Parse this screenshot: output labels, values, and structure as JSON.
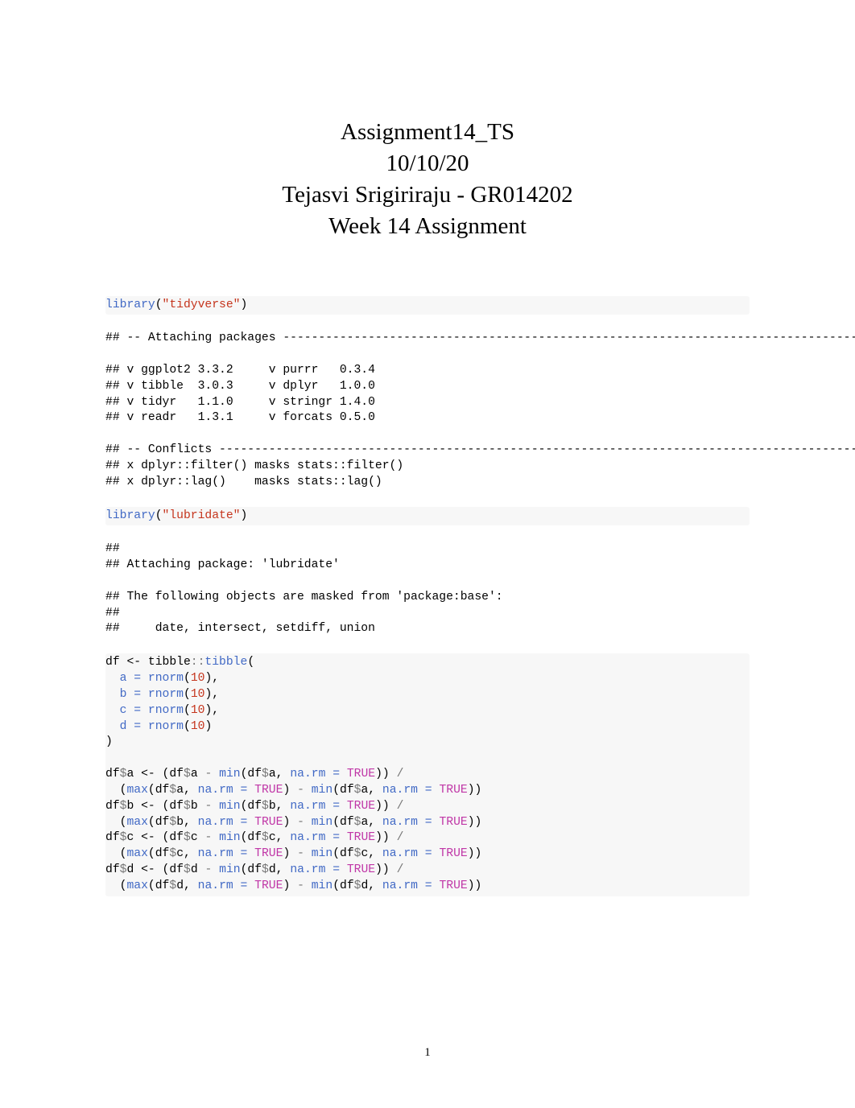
{
  "title": {
    "line1": "Assignment14_TS",
    "line2": "10/10/20",
    "line3": "Tejasvi Srigiriraju - GR014202",
    "line4": "Week 14 Assignment"
  },
  "code1_a": "library",
  "code1_b": "(",
  "code1_c": "\"tidyverse\"",
  "code1_d": ")",
  "output1": "## -- Attaching packages ---------------------------------------------------------------------------------",
  "packages": {
    "l1": "## v ggplot2 3.3.2     v purrr   0.3.4",
    "l2": "## v tibble  3.0.3     v dplyr   1.0.0",
    "l3": "## v tidyr   1.1.0     v stringr 1.4.0",
    "l4": "## v readr   1.3.1     v forcats 0.5.0"
  },
  "conflicts": {
    "l1": "## -- Conflicts ------------------------------------------------------------------------------------------",
    "l2": "## x dplyr::filter() masks stats::filter()",
    "l3": "## x dplyr::lag()    masks stats::lag()"
  },
  "code2_a": "library",
  "code2_b": "(",
  "code2_c": "\"lubridate\"",
  "code2_d": ")",
  "lubridate": {
    "l1": "##",
    "l2": "## Attaching package: 'lubridate'",
    "l3": "## The following objects are masked from 'package:base':",
    "l4": "##",
    "l5": "##     date, intersect, setdiff, union"
  },
  "df": {
    "l1a": "df <-",
    "l1b": " tibble",
    "l1c": "::",
    "l1d": "tibble",
    "l1e": "(",
    "l2a": "  ",
    "l2b": "a =",
    "l2c": " ",
    "l2d": "rnorm",
    "l2e": "(",
    "l2f": "10",
    "l2g": "),",
    "l3a": "  ",
    "l3b": "b =",
    "l3c": " ",
    "l3d": "rnorm",
    "l3e": "(",
    "l3f": "10",
    "l3g": "),",
    "l4a": "  ",
    "l4b": "c =",
    "l4c": " ",
    "l4d": "rnorm",
    "l4e": "(",
    "l4f": "10",
    "l4g": "),",
    "l5a": "  ",
    "l5b": "d =",
    "l5c": " ",
    "l5d": "rnorm",
    "l5e": "(",
    "l5f": "10",
    "l5g": ")",
    "l6": ")"
  },
  "r": {
    "a1a": "df",
    "a1b": "$",
    "a1c": "a <-",
    "a1d": " (df",
    "a1e": "$",
    "a1f": "a ",
    "a1g": "-",
    "a1h": " ",
    "a1i": "min",
    "a1j": "(df",
    "a1k": "$",
    "a1l": "a, ",
    "a1m": "na.rm =",
    "a1n": " ",
    "a1o": "TRUE",
    "a1p": ")) ",
    "a1q": "/",
    "a2a": "  (",
    "a2b": "max",
    "a2c": "(df",
    "a2d": "$",
    "a2e": "a, ",
    "a2f": "na.rm =",
    "a2g": " ",
    "a2h": "TRUE",
    "a2i": ") ",
    "a2j": "-",
    "a2k": " ",
    "a2l": "min",
    "a2m": "(df",
    "a2n": "$",
    "a2o": "a, ",
    "a2p": "na.rm =",
    "a2q": " ",
    "a2r": "TRUE",
    "a2s": "))",
    "b1a": "df",
    "b1b": "$",
    "b1c": "b <-",
    "b1d": " (df",
    "b1e": "$",
    "b1f": "b ",
    "b1g": "-",
    "b1h": " ",
    "b1i": "min",
    "b1j": "(df",
    "b1k": "$",
    "b1l": "b, ",
    "b1m": "na.rm =",
    "b1n": " ",
    "b1o": "TRUE",
    "b1p": ")) ",
    "b1q": "/",
    "b2a": "  (",
    "b2b": "max",
    "b2c": "(df",
    "b2d": "$",
    "b2e": "b, ",
    "b2f": "na.rm =",
    "b2g": " ",
    "b2h": "TRUE",
    "b2i": ") ",
    "b2j": "-",
    "b2k": " ",
    "b2l": "min",
    "b2m": "(df",
    "b2n": "$",
    "b2o": "a, ",
    "b2p": "na.rm =",
    "b2q": " ",
    "b2r": "TRUE",
    "b2s": "))",
    "c1a": "df",
    "c1b": "$",
    "c1c": "c <-",
    "c1d": " (df",
    "c1e": "$",
    "c1f": "c ",
    "c1g": "-",
    "c1h": " ",
    "c1i": "min",
    "c1j": "(df",
    "c1k": "$",
    "c1l": "c, ",
    "c1m": "na.rm =",
    "c1n": " ",
    "c1o": "TRUE",
    "c1p": ")) ",
    "c1q": "/",
    "c2a": "  (",
    "c2b": "max",
    "c2c": "(df",
    "c2d": "$",
    "c2e": "c, ",
    "c2f": "na.rm =",
    "c2g": " ",
    "c2h": "TRUE",
    "c2i": ") ",
    "c2j": "-",
    "c2k": " ",
    "c2l": "min",
    "c2m": "(df",
    "c2n": "$",
    "c2o": "c, ",
    "c2p": "na.rm =",
    "c2q": " ",
    "c2r": "TRUE",
    "c2s": "))",
    "d1a": "df",
    "d1b": "$",
    "d1c": "d <-",
    "d1d": " (df",
    "d1e": "$",
    "d1f": "d ",
    "d1g": "-",
    "d1h": " ",
    "d1i": "min",
    "d1j": "(df",
    "d1k": "$",
    "d1l": "d, ",
    "d1m": "na.rm =",
    "d1n": " ",
    "d1o": "TRUE",
    "d1p": ")) ",
    "d1q": "/",
    "d2a": "  (",
    "d2b": "max",
    "d2c": "(df",
    "d2d": "$",
    "d2e": "d, ",
    "d2f": "na.rm =",
    "d2g": " ",
    "d2h": "TRUE",
    "d2i": ") ",
    "d2j": "-",
    "d2k": " ",
    "d2l": "min",
    "d2m": "(df",
    "d2n": "$",
    "d2o": "d, ",
    "d2p": "na.rm =",
    "d2q": " ",
    "d2r": "TRUE",
    "d2s": "))"
  },
  "page": "1"
}
